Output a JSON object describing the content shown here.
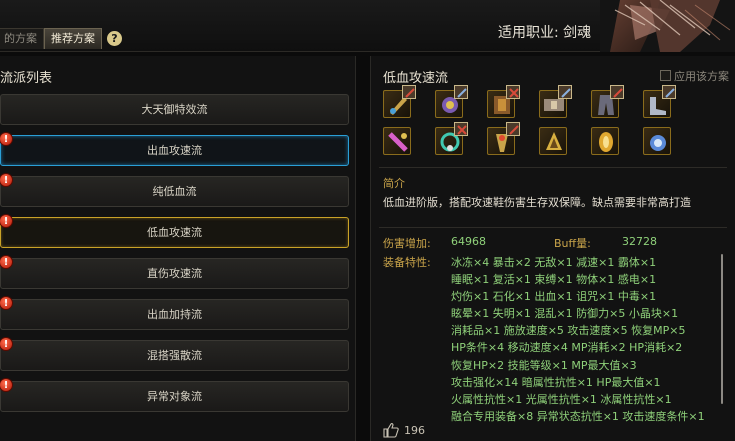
{
  "header": {
    "tabs": [
      "的方案",
      "推荐方案"
    ],
    "help_label": "?",
    "job_label": "适用职业: 剑魂"
  },
  "left": {
    "title": "流派列表",
    "items": [
      {
        "label": "大天御特效流",
        "warn": false,
        "state": "normal"
      },
      {
        "label": "出血攻速流",
        "warn": true,
        "state": "blue"
      },
      {
        "label": "纯低血流",
        "warn": true,
        "state": "normal"
      },
      {
        "label": "低血攻速流",
        "warn": true,
        "state": "gold"
      },
      {
        "label": "直伤攻速流",
        "warn": true,
        "state": "normal"
      },
      {
        "label": "出血加持流",
        "warn": true,
        "state": "normal"
      },
      {
        "label": "混搭强散流",
        "warn": true,
        "state": "normal"
      },
      {
        "label": "异常对象流",
        "warn": true,
        "state": "normal"
      }
    ],
    "warn_glyph": "!"
  },
  "right": {
    "title": "低血攻速流",
    "apply_label": "应用该方案",
    "equip_icons": [
      "weapon-icon",
      "hat-icon",
      "chest-icon",
      "belt-icon",
      "pants-icon",
      "shoes-icon",
      "bracelet-icon",
      "necklace-icon",
      "ring-icon",
      "support-icon",
      "magic-stone-icon",
      "earring-icon"
    ],
    "intro_title": "简介",
    "intro_text": "低血进阶版，搭配攻速鞋伤害生存双保障。缺点需要非常高打造",
    "damage_label": "伤害增加:",
    "damage_value": "64968",
    "buff_label": "Buff量:",
    "buff_value": "32728",
    "traits_label": "装备特性:",
    "traits": [
      "冰冻×4   暴击×2   无敌×1   减速×1   霸体×1",
      "睡眠×1   复活×1   束缚×1   物体×1   感电×1",
      "灼伤×1   石化×1   出血×1   诅咒×1   中毒×1",
      "眩晕×1   失明×1   混乱×1   防御力×5   小晶块×1",
      "消耗品×1   施放速度×5   攻击速度×5   恢复MP×5",
      "HP条件×4   移动速度×4   MP消耗×2   HP消耗×2",
      "恢复HP×2   技能等级×1   MP最大值×3",
      "攻击强化×14   暗属性抗性×1   HP最大值×1",
      "火属性抗性×1   光属性抗性×1   冰属性抗性×1",
      "融合专用装备×8   异常状态抗性×1   攻击速度条件×1"
    ],
    "like_count": "196"
  },
  "colors": {
    "accent_gold": "#c9a44a",
    "trait_green": "#8fd17a",
    "selected_blue": "#2a9fd6",
    "selected_gold": "#c9a227",
    "warn_red": "#d02a10"
  }
}
